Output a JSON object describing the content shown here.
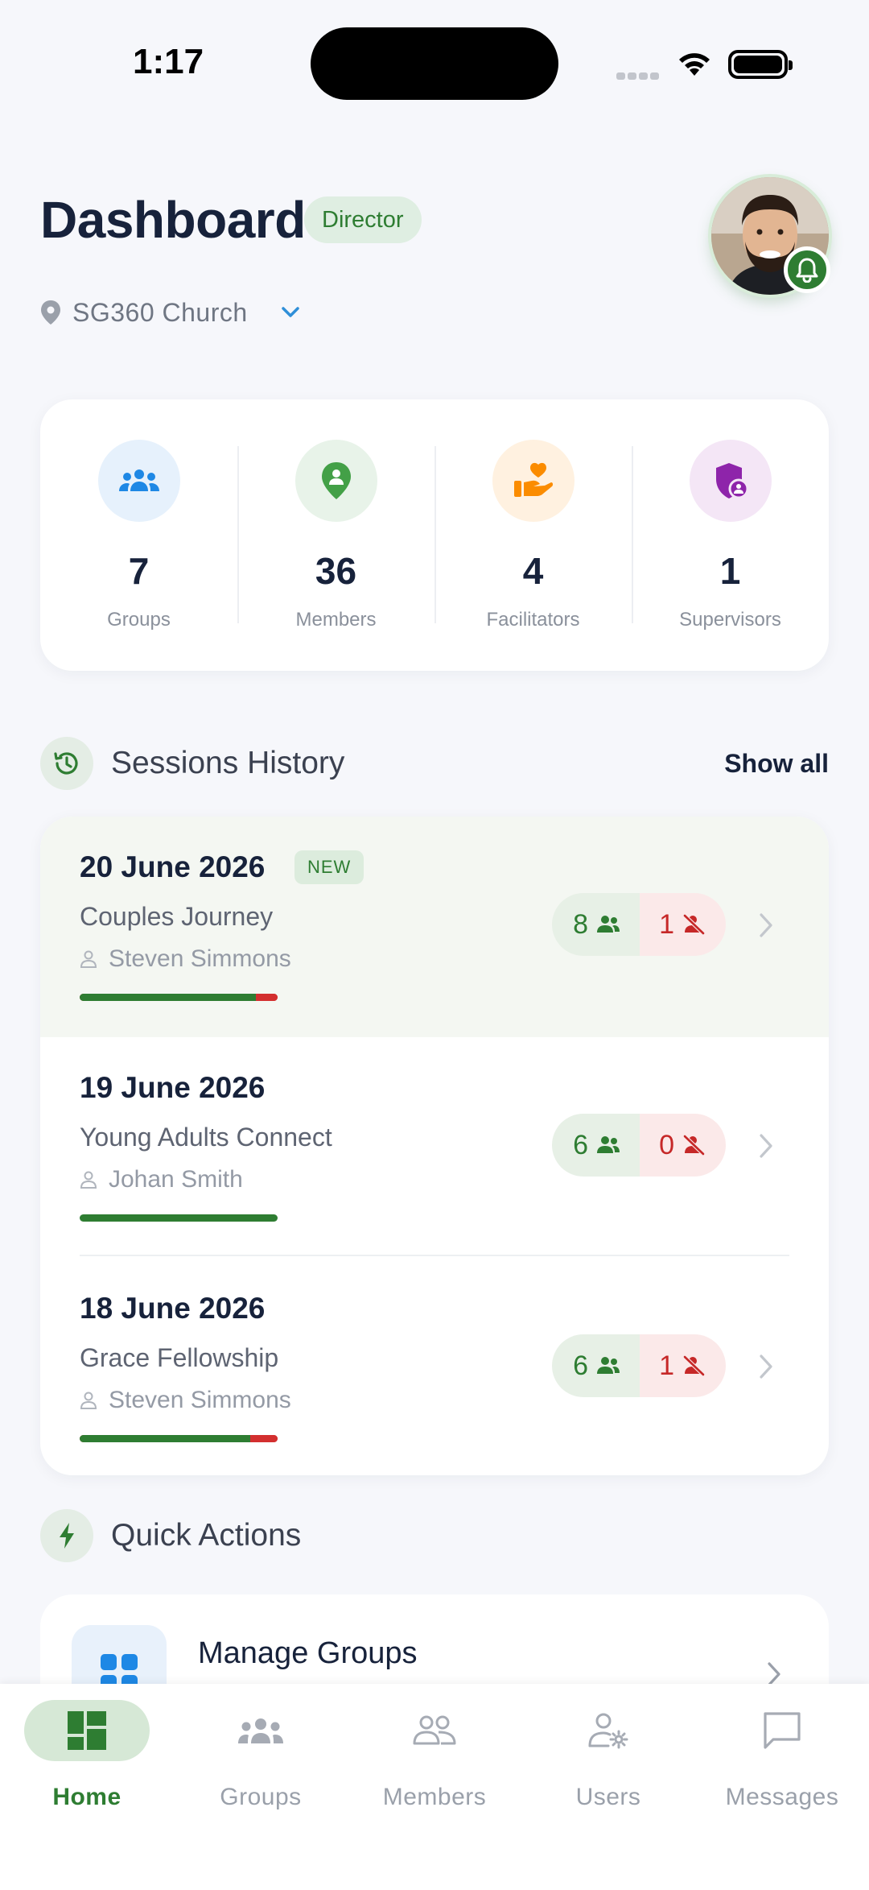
{
  "status_bar": {
    "time": "1:17"
  },
  "header": {
    "title": "Dashboard",
    "role_badge": "Director",
    "location": "SG360 Church"
  },
  "stats": [
    {
      "value": "7",
      "label": "Groups",
      "color": "#1e88e5",
      "bg": "#e6f1fc",
      "icon": "groups-icon"
    },
    {
      "value": "36",
      "label": "Members",
      "color": "#43a047",
      "bg": "#e8f3e9",
      "icon": "member-pin-icon"
    },
    {
      "value": "4",
      "label": "Facilitators",
      "color": "#fb8c00",
      "bg": "#fff1e0",
      "icon": "hand-heart-icon"
    },
    {
      "value": "1",
      "label": "Supervisors",
      "color": "#8e24aa",
      "bg": "#f4e6f6",
      "icon": "shield-user-icon"
    }
  ],
  "sessions_section": {
    "title": "Sessions History",
    "show_all": "Show all"
  },
  "sessions": [
    {
      "date": "20 June 2026",
      "badge": "NEW",
      "group": "Couples Journey",
      "leader": "Steven Simmons",
      "present": "8",
      "absent": "1",
      "present_ratio": 0.89
    },
    {
      "date": "19 June 2026",
      "group": "Young Adults Connect",
      "leader": "Johan Smith",
      "present": "6",
      "absent": "0",
      "present_ratio": 1.0
    },
    {
      "date": "18 June 2026",
      "group": "Grace Fellowship",
      "leader": "Steven Simmons",
      "present": "6",
      "absent": "1",
      "present_ratio": 0.86
    }
  ],
  "quick_actions": {
    "title": "Quick Actions",
    "items": [
      {
        "label": "Manage Groups"
      }
    ]
  },
  "tabs": [
    {
      "label": "Home",
      "active": true
    },
    {
      "label": "Groups"
    },
    {
      "label": "Members"
    },
    {
      "label": "Users"
    },
    {
      "label": "Messages"
    }
  ],
  "colors": {
    "primary": "#2e7d32",
    "absent": "#c62828",
    "text": "#17223b"
  }
}
